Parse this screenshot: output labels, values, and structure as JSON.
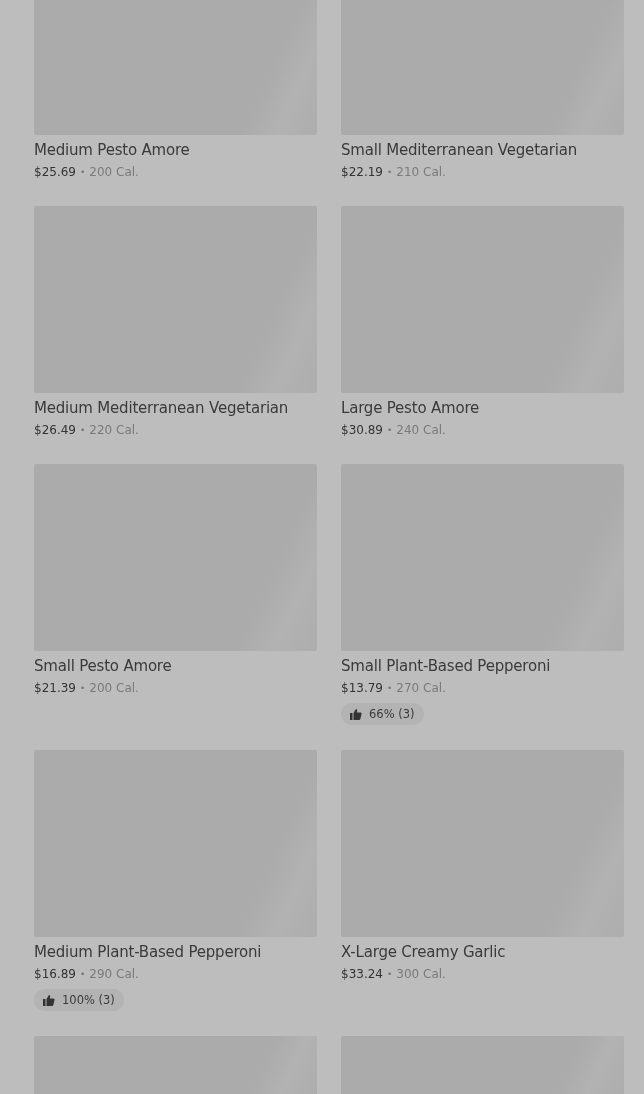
{
  "items": [
    {
      "kind": "full",
      "name": "Medium Pesto Amore",
      "price": "$25.69",
      "separator": "•",
      "calories": "200 Cal."
    },
    {
      "kind": "full",
      "name": "Small Mediterranean Vegetarian",
      "price": "$22.19",
      "separator": "•",
      "calories": "210 Cal."
    },
    {
      "kind": "full",
      "name": "Medium Mediterranean Vegetarian",
      "price": "$26.49",
      "separator": "•",
      "calories": "220 Cal."
    },
    {
      "kind": "full",
      "name": "Large Pesto Amore",
      "price": "$30.89",
      "separator": "•",
      "calories": "240 Cal."
    },
    {
      "kind": "full",
      "name": "Small Pesto Amore",
      "price": "$21.39",
      "separator": "•",
      "calories": "200 Cal."
    },
    {
      "kind": "full",
      "name": "Small Plant-Based Pepperoni",
      "price": "$13.79",
      "separator": "•",
      "calories": "270 Cal.",
      "rating": "66% (3)"
    },
    {
      "kind": "full",
      "name": "Medium Plant-Based Pepperoni",
      "price": "$16.89",
      "separator": "•",
      "calories": "290 Cal.",
      "rating": "100% (3)"
    },
    {
      "kind": "full",
      "name": "X-Large Creamy Garlic",
      "price": "$33.24",
      "separator": "•",
      "calories": "300 Cal."
    },
    {
      "kind": "image-only"
    },
    {
      "kind": "image-only"
    }
  ]
}
